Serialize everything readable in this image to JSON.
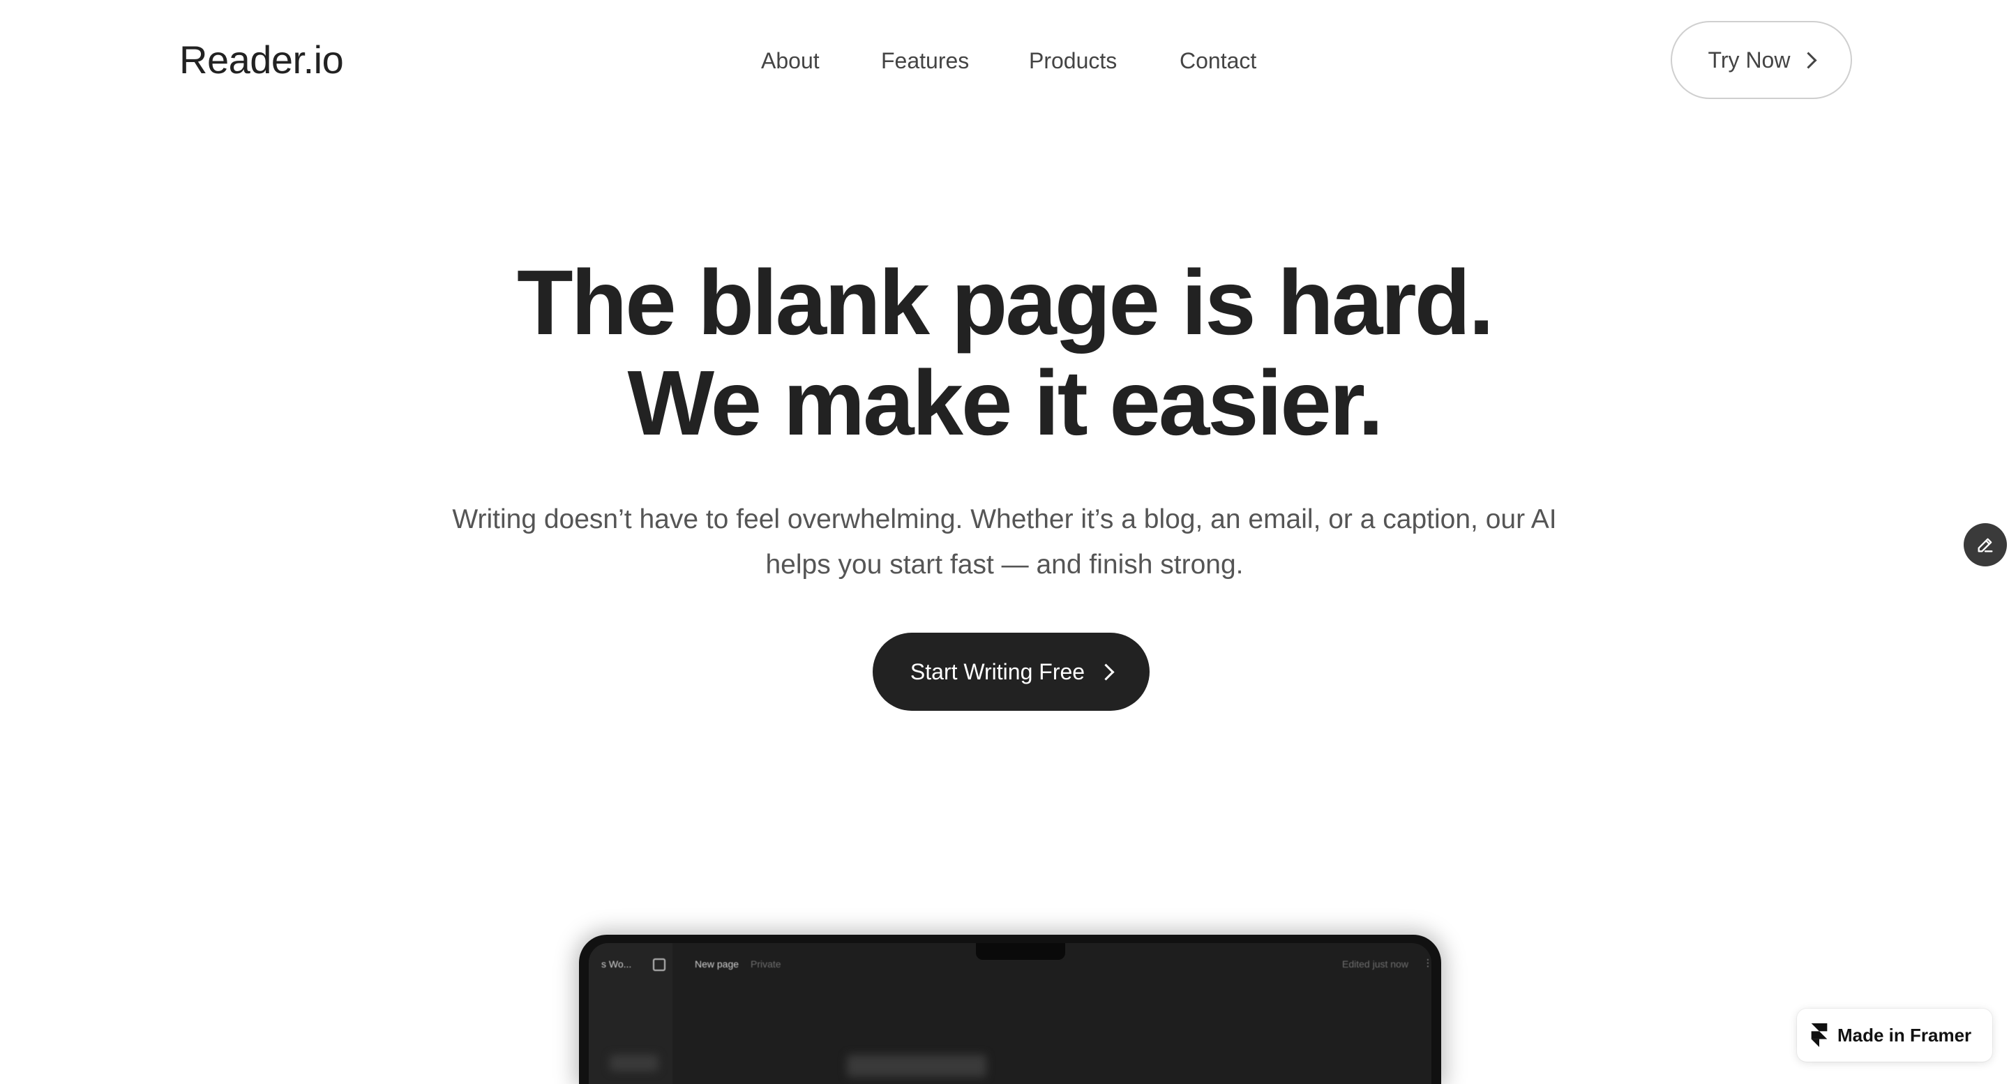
{
  "header": {
    "logo": "Reader.io",
    "nav": [
      {
        "label": "About"
      },
      {
        "label": "Features"
      },
      {
        "label": "Products"
      },
      {
        "label": "Contact"
      }
    ],
    "cta_label": "Try Now"
  },
  "hero": {
    "title_line1": "The blank page is hard.",
    "title_line2": "We make it easier.",
    "subtitle": "Writing doesn’t have to feel overwhelming. Whether it’s a blog, an email, or a caption, our AI helps you start fast — and finish strong.",
    "cta_label": "Start Writing Free"
  },
  "device_preview": {
    "workspace_label": "s Wo...",
    "page_title": "New page",
    "privacy": "Private",
    "edited_status": "Edited just now"
  },
  "badge": {
    "label": "Made in Framer"
  },
  "icons": {
    "chevron": "chevron-right-icon",
    "edit": "pencil-icon",
    "framer": "framer-logo-icon"
  },
  "colors": {
    "text_primary": "#222222",
    "text_secondary": "#555555",
    "button_dark": "#222222",
    "background": "#ffffff"
  }
}
